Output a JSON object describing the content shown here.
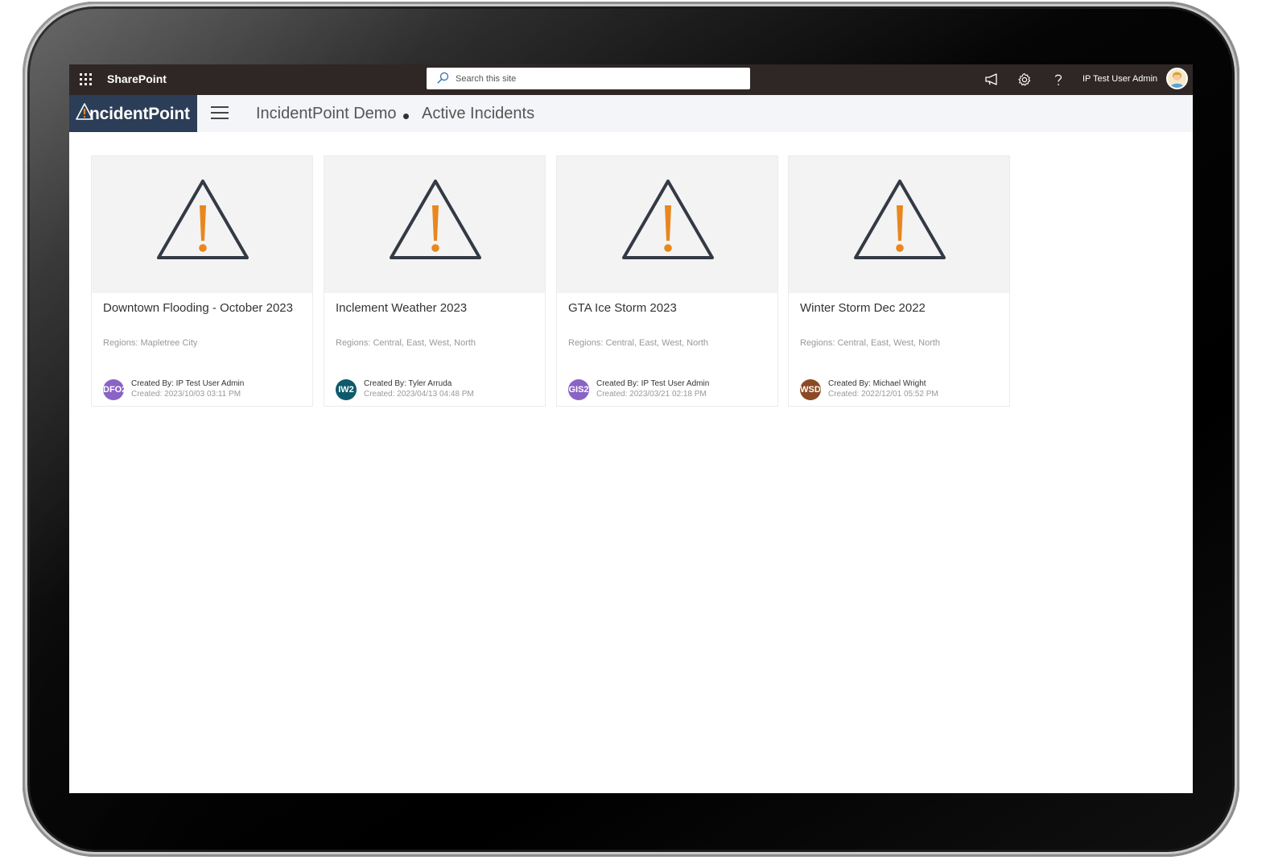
{
  "suite_bar": {
    "app_name": "SharePoint",
    "search_placeholder": "Search this site",
    "user_name": "IP Test User Admin"
  },
  "site_header": {
    "logo_text": "ncidentPoint",
    "breadcrumb": [
      "IncidentPoint Demo",
      "Active Incidents"
    ]
  },
  "colors": {
    "suite_bar_bg": "#2e2726",
    "logo_bg": "#2c3d58",
    "warning_orange": "#e8871e",
    "warning_outline": "#333a44"
  },
  "cards": [
    {
      "title": "Downtown Flooding - October 2023",
      "regions": "Regions: Mapletree City",
      "initials": "DFO2",
      "initials_color": "#8a63c4",
      "created_by": "Created By: IP Test User Admin",
      "created": "Created: 2023/10/03 03:11 PM",
      "icon": "warning-triangle-icon"
    },
    {
      "title": "Inclement Weather 2023",
      "regions": "Regions: Central, East, West, North",
      "initials": "IW2",
      "initials_color": "#0e5a6b",
      "created_by": "Created By: Tyler Arruda",
      "created": "Created: 2023/04/13 04:48 PM",
      "icon": "warning-triangle-icon"
    },
    {
      "title": "GTA Ice Storm 2023",
      "regions": "Regions: Central, East, West, North",
      "initials": "GIS2",
      "initials_color": "#8a63c4",
      "created_by": "Created By: IP Test User Admin",
      "created": "Created: 2023/03/21 02:18 PM",
      "icon": "warning-triangle-icon"
    },
    {
      "title": "Winter Storm Dec 2022",
      "regions": "Regions: Central, East, West, North",
      "initials": "WSD",
      "initials_color": "#8b4a24",
      "created_by": "Created By: Michael Wright",
      "created": "Created: 2022/12/01 05:52 PM",
      "icon": "warning-triangle-icon"
    }
  ]
}
